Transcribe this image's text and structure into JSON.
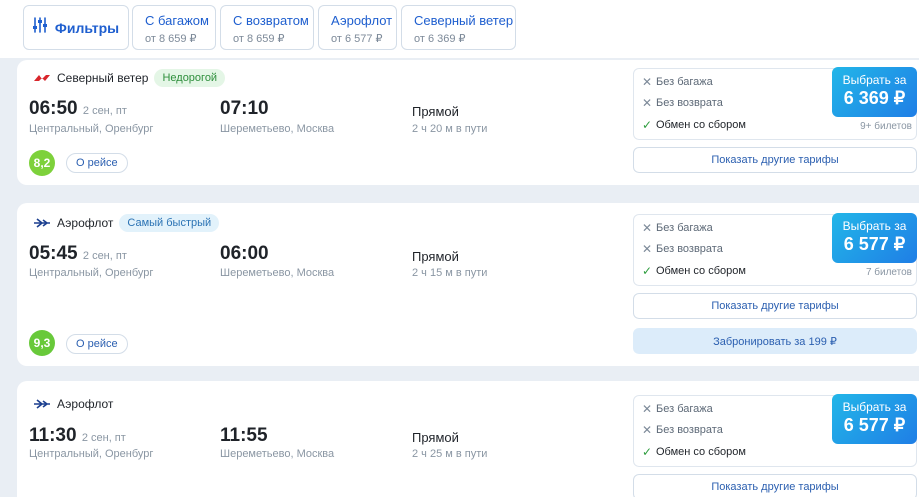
{
  "filters": {
    "main_label": "Фильтры",
    "chips": [
      {
        "title": "С багажом",
        "sub": "от 8 659 ₽"
      },
      {
        "title": "С возвратом",
        "sub": "от 8 659 ₽"
      },
      {
        "title": "Аэрофлот",
        "sub": "от 6 577 ₽"
      },
      {
        "title": "Северный ветер",
        "sub": "от 6 369 ₽"
      }
    ]
  },
  "flights": [
    {
      "airline": "Северный ветер",
      "tag": "Недорогой",
      "dep_time": "06:50",
      "dep_date": "2 сен, пт",
      "dep_place": "Центральный, Оренбург",
      "arr_time": "07:10",
      "arr_place": "Шереметьево, Москва",
      "direct": "Прямой",
      "duration": "2 ч 20 м в пути",
      "rating": "8,2",
      "about": "О рейсе",
      "features": [
        "Без багажа",
        "Без возврата",
        "Обмен со сбором"
      ],
      "buy_label": "Выбрать за",
      "price": "6 369 ₽",
      "tickets": "9+ билетов",
      "other_tariffs": "Показать другие тарифы"
    },
    {
      "airline": "Аэрофлот",
      "tag": "Самый быстрый",
      "dep_time": "05:45",
      "dep_date": "2 сен, пт",
      "dep_place": "Центральный, Оренбург",
      "arr_time": "06:00",
      "arr_place": "Шереметьево, Москва",
      "direct": "Прямой",
      "duration": "2 ч 15 м в пути",
      "rating": "9,3",
      "about": "О рейсе",
      "features": [
        "Без багажа",
        "Без возврата",
        "Обмен со сбором"
      ],
      "buy_label": "Выбрать за",
      "price": "6 577 ₽",
      "tickets": "7 билетов",
      "other_tariffs": "Показать другие тарифы",
      "book": "Забронировать за 199 ₽"
    },
    {
      "airline": "Аэрофлот",
      "dep_time": "11:30",
      "dep_date": "2 сен, пт",
      "dep_place": "Центральный, Оренбург",
      "arr_time": "11:55",
      "arr_place": "Шереметьево, Москва",
      "direct": "Прямой",
      "duration": "2 ч 25 м в пути",
      "features": [
        "Без багажа",
        "Без возврата",
        "Обмен со сбором"
      ],
      "buy_label": "Выбрать за",
      "price": "6 577 ₽",
      "other_tariffs": "Показать другие тарифы"
    }
  ]
}
